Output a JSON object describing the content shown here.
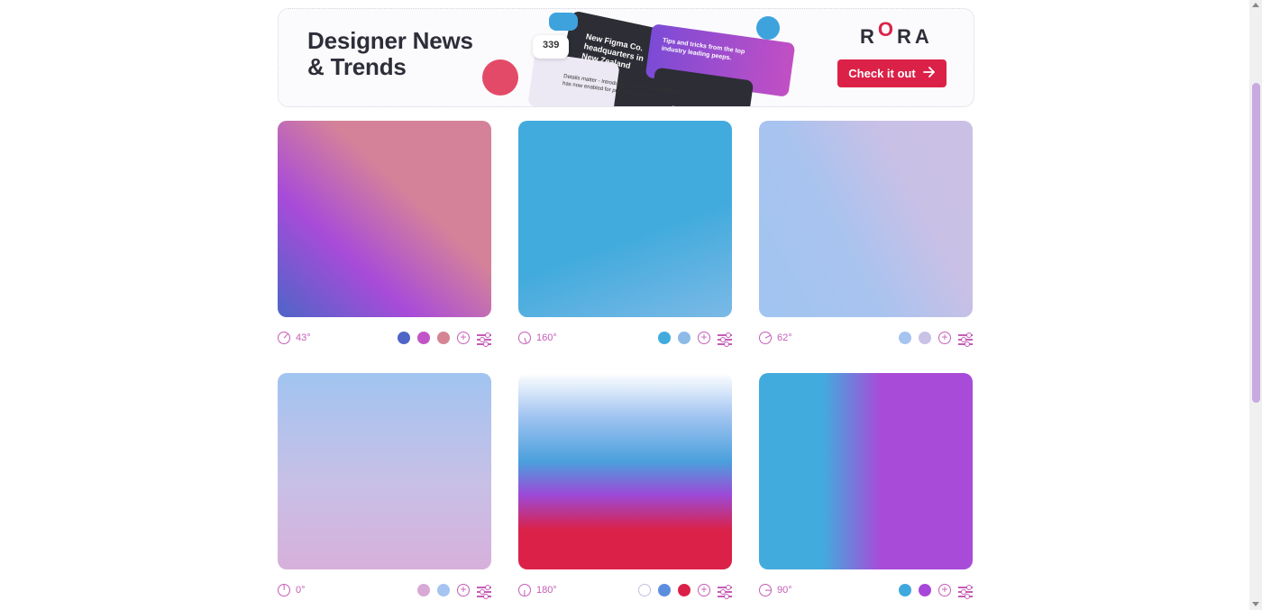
{
  "banner": {
    "title": "Designer News\n& Trends",
    "brand": {
      "r": "R",
      "o": "O",
      "ra": "RA"
    },
    "cta_label": "Check it out",
    "mock": {
      "count": "339",
      "headline": "New Figma Co.\nheadquarters in\nNew Zealand",
      "tips": "Tips and tricks from the top\nindustry leading peeps.",
      "caption": "Details matter - Introducing PDF Export in Figma\nhas now enabled for premium users to..."
    }
  },
  "gradients": [
    {
      "angle": "43°",
      "angle_deg": 43,
      "colors": [
        "#4e65c7",
        "#c155c7",
        "#d58493"
      ],
      "css": "linear-gradient(43deg,#4e65c7 0%,#a84bd9 32%,#d4829a 62%,#d4829a 100%)"
    },
    {
      "angle": "160°",
      "angle_deg": 160,
      "colors": [
        "#42abdd",
        "#8ebae8"
      ],
      "css": "linear-gradient(160deg,#42abdd 0%,#42abdd 58%,#7bb9e6 100%)"
    },
    {
      "angle": "62°",
      "angle_deg": 62,
      "colors": [
        "#a6c4f0",
        "#c9c1e6"
      ],
      "css": "linear-gradient(62deg,#a1c4f1 0%,#a9c3ef 40%,#c9c0e6 70%,#cac0e6 100%)"
    },
    {
      "angle": "0°",
      "angle_deg": 0,
      "colors": [
        "#d9a9d6",
        "#a6c4f0"
      ],
      "css": "linear-gradient(0deg,#d7b0db 0%,#c7c0e6 45%,#a1c4f1 100%)"
    },
    {
      "angle": "180°",
      "angle_deg": 180,
      "colors": [
        "#ffffff",
        "#5c8ede",
        "#db2148"
      ],
      "css": "linear-gradient(180deg,#ffffff 0%,#a1c4f1 22%,#4aa0dc 45%,#9c4ad7 62%,#db2148 80%,#db2148 100%)"
    },
    {
      "angle": "90°",
      "angle_deg": 90,
      "colors": [
        "#3fa8dd",
        "#a747d9"
      ],
      "css": "linear-gradient(90deg,#42abdd 0%,#42abdd 30%,#a84bd9 57%,#a84bd9 100%)"
    }
  ],
  "icons": {
    "plus": "+"
  },
  "accent": "#c55db7",
  "scroll_thumb_color": "#c8a9e0"
}
